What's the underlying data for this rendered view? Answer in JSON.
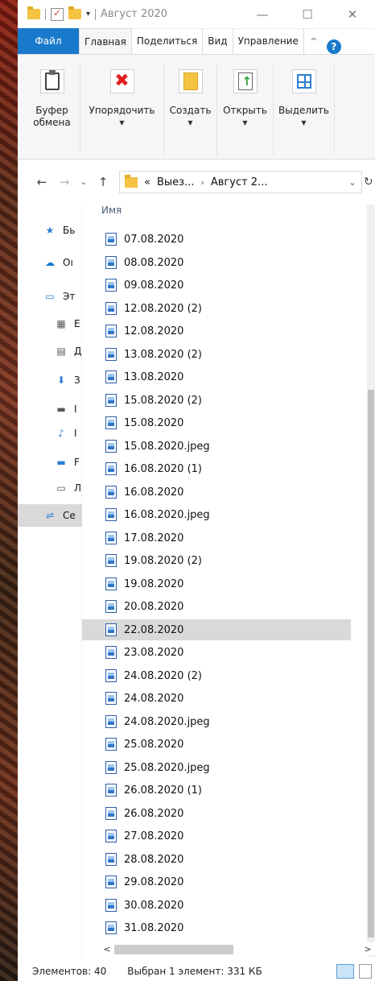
{
  "titlebar": {
    "title": "Август 2020",
    "minimize": "—",
    "maximize": "☐",
    "close": "✕"
  },
  "tabs": {
    "file": "Файл",
    "home": "Главная",
    "share": "Поделиться",
    "view": "Вид",
    "manage": "Управление",
    "collapse": "^",
    "help": "?"
  },
  "ribbon": {
    "clipboard": "Буфер обмена",
    "organize": "Упорядочить",
    "create": "Создать",
    "open": "Открыть",
    "select": "Выделить"
  },
  "navbar": {
    "back": "←",
    "forward": "→",
    "recent": "⌄",
    "up": "↑",
    "crumb_prefix": "«",
    "crumb1": "Выез...",
    "crumb_sep": "›",
    "crumb2": "Август 2...",
    "dropdown": "⌄",
    "refresh": "↻"
  },
  "nav_pane": {
    "items": [
      {
        "label": "Бь",
        "icon": "star-icon"
      },
      {
        "label": "Oı",
        "icon": "cloud-icon"
      },
      {
        "label": "Эт",
        "icon": "computer-icon"
      },
      {
        "label": "E",
        "icon": "video-icon"
      },
      {
        "label": "Д",
        "icon": "document-icon"
      },
      {
        "label": "З",
        "icon": "download-icon"
      },
      {
        "label": "I",
        "icon": "pictures-icon"
      },
      {
        "label": "I",
        "icon": "music-icon"
      },
      {
        "label": "F",
        "icon": "desktop-icon"
      },
      {
        "label": "Л",
        "icon": "drive-icon"
      },
      {
        "label": "Се",
        "icon": "network-icon"
      }
    ]
  },
  "file_list": {
    "column_name": "Имя",
    "files": [
      "07.08.2020",
      "08.08.2020",
      "09.08.2020",
      "12.08.2020 (2)",
      "12.08.2020",
      "13.08.2020 (2)",
      "13.08.2020",
      "15.08.2020 (2)",
      "15.08.2020",
      "15.08.2020.jpeg",
      "16.08.2020 (1)",
      "16.08.2020",
      "16.08.2020.jpeg",
      "17.08.2020",
      "19.08.2020 (2)",
      "19.08.2020",
      "20.08.2020",
      "22.08.2020",
      "23.08.2020",
      "24.08.2020 (2)",
      "24.08.2020",
      "24.08.2020.jpeg",
      "25.08.2020",
      "25.08.2020.jpeg",
      "26.08.2020 (1)",
      "26.08.2020",
      "27.08.2020",
      "28.08.2020",
      "29.08.2020",
      "30.08.2020",
      "31.08.2020"
    ],
    "selected": "22.08.2020"
  },
  "hscroll": {
    "left": "<",
    "right": ">"
  },
  "status": {
    "count": "Элементов: 40",
    "selection": "Выбран 1 элемент: 331 КБ"
  },
  "colors": {
    "accent": "#1979ca",
    "selected_bg": "#d9d9d9",
    "folder": "#f5c342"
  }
}
